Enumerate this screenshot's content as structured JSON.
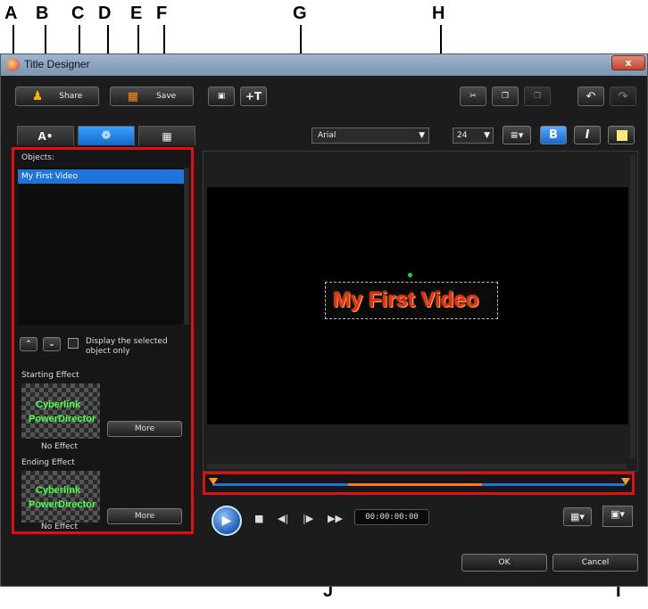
{
  "callouts": [
    "A",
    "B",
    "C",
    "D",
    "E",
    "F",
    "G",
    "H",
    "I",
    "J"
  ],
  "window": {
    "title": "Title Designer",
    "close_label": "x"
  },
  "toolbar": {
    "share_label": "Share",
    "save_label": "Save"
  },
  "objects": {
    "header": "Objects:",
    "items": [
      "My First Video"
    ]
  },
  "display_selected_label": "Display the selected object only",
  "starting_effect": {
    "label": "Starting Effect",
    "thumb_line1": "Cyberlink",
    "thumb_line2": "PowerDirector",
    "value": "No Effect",
    "more_label": "More"
  },
  "ending_effect": {
    "label": "Ending Effect",
    "thumb_line1": "Cyberlink",
    "thumb_line2": "PowerDirector",
    "value": "No Effect",
    "more_label": "More"
  },
  "format": {
    "font": "Arial",
    "size": "24",
    "bold": "B",
    "italic": "I"
  },
  "preview": {
    "title_text": "My First Video"
  },
  "timecode": "00:00:00:00",
  "dialog": {
    "ok_label": "OK",
    "cancel_label": "Cancel"
  },
  "colors": {
    "accent": "#1e74d8",
    "highlight": "#e01010",
    "title_red": "#e8301c",
    "title_orange": "#ff9a2a"
  }
}
